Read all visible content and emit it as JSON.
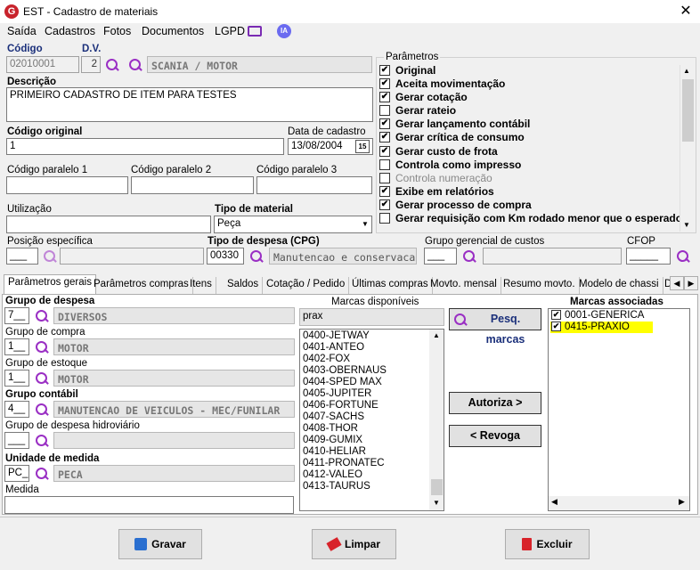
{
  "window": {
    "title": "EST - Cadastro de materiais",
    "logo": "G",
    "close": "✕"
  },
  "menu": [
    "Saída",
    "Cadastros",
    "Fotos",
    "Documentos",
    "LGPD"
  ],
  "ia_badge": "IA",
  "fields": {
    "codigo_label": "Código",
    "codigo": "02010001",
    "dv_label": "D.V.",
    "dv": "2",
    "codigo_desc": "SCANIA / MOTOR",
    "descricao_label": "Descrição",
    "descricao": "PRIMEIRO CADASTRO DE ITEM PARA TESTES",
    "cod_original_label": "Código original",
    "cod_original": "1",
    "data_cadastro_label": "Data de cadastro",
    "data_cadastro": "13/08/2004",
    "cal_icon_text": "15",
    "cod_paralelo1_label": "Código paralelo 1",
    "cod_paralelo2_label": "Código paralelo 2",
    "cod_paralelo3_label": "Código paralelo 3",
    "utilizacao_label": "Utilização",
    "tipo_material_label": "Tipo de material",
    "tipo_material": "Peça",
    "posicao_label": "Posição específica",
    "posicao": "___",
    "tipo_despesa_label": "Tipo de despesa (CPG)",
    "tipo_despesa_cod": "00330",
    "tipo_despesa_desc": "Manutencao e conservacao",
    "grupo_gerencial_label": "Grupo gerencial de custos",
    "grupo_gerencial": "___",
    "cfop_label": "CFOP",
    "cfop": "_____"
  },
  "parametros": {
    "title": "Parâmetros",
    "items": [
      {
        "label": "Original",
        "checked": "✔"
      },
      {
        "label": "Aceita movimentação",
        "checked": "✔"
      },
      {
        "label": "Gerar cotação",
        "checked": "✔"
      },
      {
        "label": "Gerar rateio",
        "checked": ""
      },
      {
        "label": "Gerar lançamento contábil",
        "checked": "✔"
      },
      {
        "label": "Gerar crítica de consumo",
        "checked": "✔"
      },
      {
        "label": "Gerar custo de frota",
        "checked": "✔"
      },
      {
        "label": "Controla como impresso",
        "checked": ""
      },
      {
        "label": "Controla numeração",
        "checked": "",
        "disabled": true
      },
      {
        "label": "Exibe em relatórios",
        "checked": "✔"
      },
      {
        "label": "Gerar processo de compra",
        "checked": "✔"
      },
      {
        "label": "Gerar requisição com Km rodado menor que o esperado",
        "checked": ""
      }
    ]
  },
  "tabs": [
    "Parâmetros gerais",
    "Parâmetros compras",
    "Itens",
    "Saldos",
    "Cotação / Pedido",
    "Últimas compras",
    "Movto. mensal",
    "Resumo movto.",
    "Modelo de chassi",
    "D"
  ],
  "geral": {
    "grupo_despesa_label": "Grupo de despesa",
    "grupo_despesa_cod": "7__",
    "grupo_despesa_desc": "DIVERSOS",
    "grupo_compra_label": "Grupo de compra",
    "grupo_compra_cod": "1__",
    "grupo_compra_desc": "MOTOR",
    "grupo_estoque_label": "Grupo de estoque",
    "grupo_estoque_cod": "1__",
    "grupo_estoque_desc": "MOTOR",
    "grupo_contabil_label": "Grupo contábil",
    "grupo_contabil_cod": "4__",
    "grupo_contabil_desc": "MANUTENCAO DE VEICULOS - MEC/FUNILAR",
    "grupo_hidroviario_label": "Grupo de despesa hidroviário",
    "grupo_hidroviario_cod": "___",
    "unidade_label": "Unidade de medida",
    "unidade_cod": "PC_",
    "unidade_desc": "PECA",
    "medida_label": "Medida"
  },
  "marcas": {
    "disponiveis_label": "Marcas disponíveis",
    "filtro": "prax",
    "disponiveis": [
      "0400-JETWAY",
      "0401-ANTEO",
      "0402-FOX",
      "0403-OBERNAUS",
      "0404-SPED MAX",
      "0405-JUPITER",
      "0406-FORTUNE",
      "0407-SACHS",
      "0408-THOR",
      "0409-GUMIX",
      "0410-HELIAR",
      "0411-PRONATEC",
      "0412-VALEO",
      "0413-TAURUS"
    ],
    "pesq_button": "Pesq. marcas",
    "autoriza_button": "Autoriza >",
    "revoga_button": "< Revoga",
    "associadas_label": "Marcas associadas",
    "associadas": [
      {
        "label": "0001-GENERICA",
        "checked": "✔",
        "highlight": false
      },
      {
        "label": "0415-PRAXIO",
        "checked": "✔",
        "highlight": true
      }
    ]
  },
  "buttons": {
    "gravar": "Gravar",
    "limpar": "Limpar",
    "excluir": "Excluir"
  },
  "colors": {
    "label_navy": "#1a2f7a",
    "accent_purple": "#9a2fc4",
    "highlight": "#ffff00"
  }
}
